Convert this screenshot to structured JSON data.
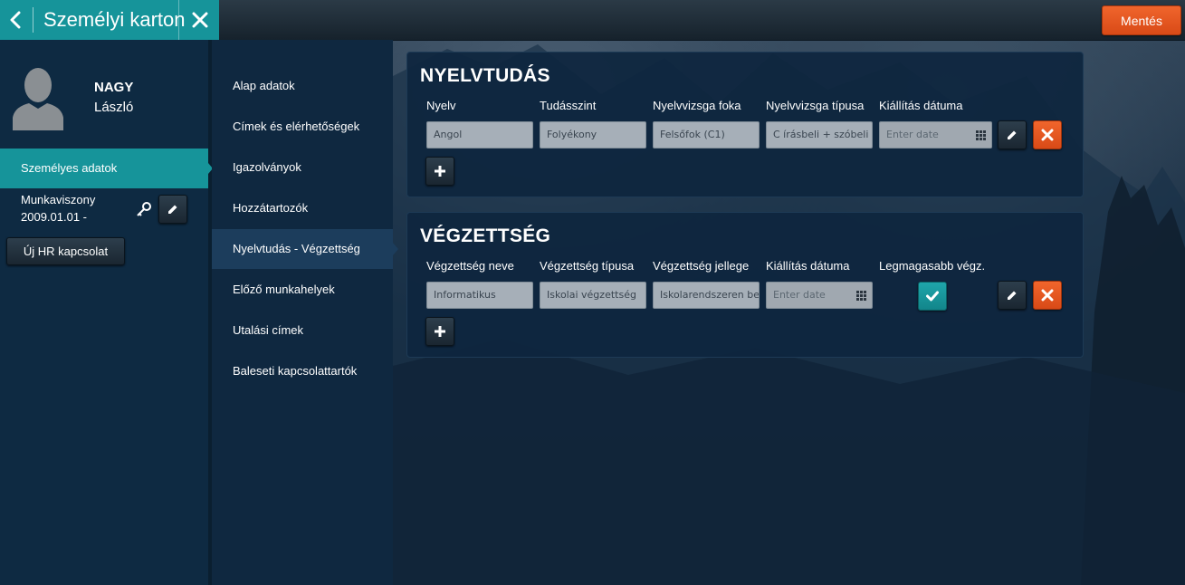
{
  "header": {
    "title": "Személyi karton",
    "save_label": "Mentés"
  },
  "profile": {
    "last_name": "NAGY",
    "first_name": "László",
    "active_item": "Személyes adatok",
    "employment_label": "Munkaviszony",
    "employment_date": "2009.01.01 -",
    "new_hr_label": "Új HR kapcsolat"
  },
  "nav": {
    "items": [
      {
        "label": "Alap adatok"
      },
      {
        "label": "Címek és elérhetőségek"
      },
      {
        "label": "Igazolványok"
      },
      {
        "label": "Hozzátartozók"
      },
      {
        "label": "Nyelvtudás - Végzettség"
      },
      {
        "label": "Előző munkahelyek"
      },
      {
        "label": "Utalási címek"
      },
      {
        "label": "Baleseti kapcsolattartók"
      }
    ],
    "active_index": 4
  },
  "language": {
    "title": "NYELVTUDÁS",
    "columns": [
      "Nyelv",
      "Tudásszint",
      "Nyelvvizsga foka",
      "Nyelvvizsga típusa",
      "Kiállítás dátuma"
    ],
    "row": {
      "language": "Angol",
      "level": "Folyékony",
      "exam_grade": "Felsőfok (C1)",
      "exam_type": "C írásbeli + szóbeli",
      "issue_date_placeholder": "Enter date"
    }
  },
  "education": {
    "title": "VÉGZETTSÉG",
    "columns": [
      "Végzettség neve",
      "Végzettség típusa",
      "Végzettség jellege",
      "Kiállítás dátuma",
      "Legmagasabb végz."
    ],
    "row": {
      "name": "Informatikus",
      "type": "Iskolai végzettség",
      "nature": "Iskolarendszeren belüli",
      "issue_date_placeholder": "Enter date",
      "highest": true
    }
  },
  "colors": {
    "teal": "#16949a",
    "orange": "#e5561f",
    "panel": "#0e263e"
  },
  "icons": [
    "chevron-left-icon",
    "close-icon",
    "user-silhouette-icon",
    "key-icon",
    "pencil-icon",
    "plus-icon",
    "calendar-grid-icon",
    "check-icon"
  ]
}
